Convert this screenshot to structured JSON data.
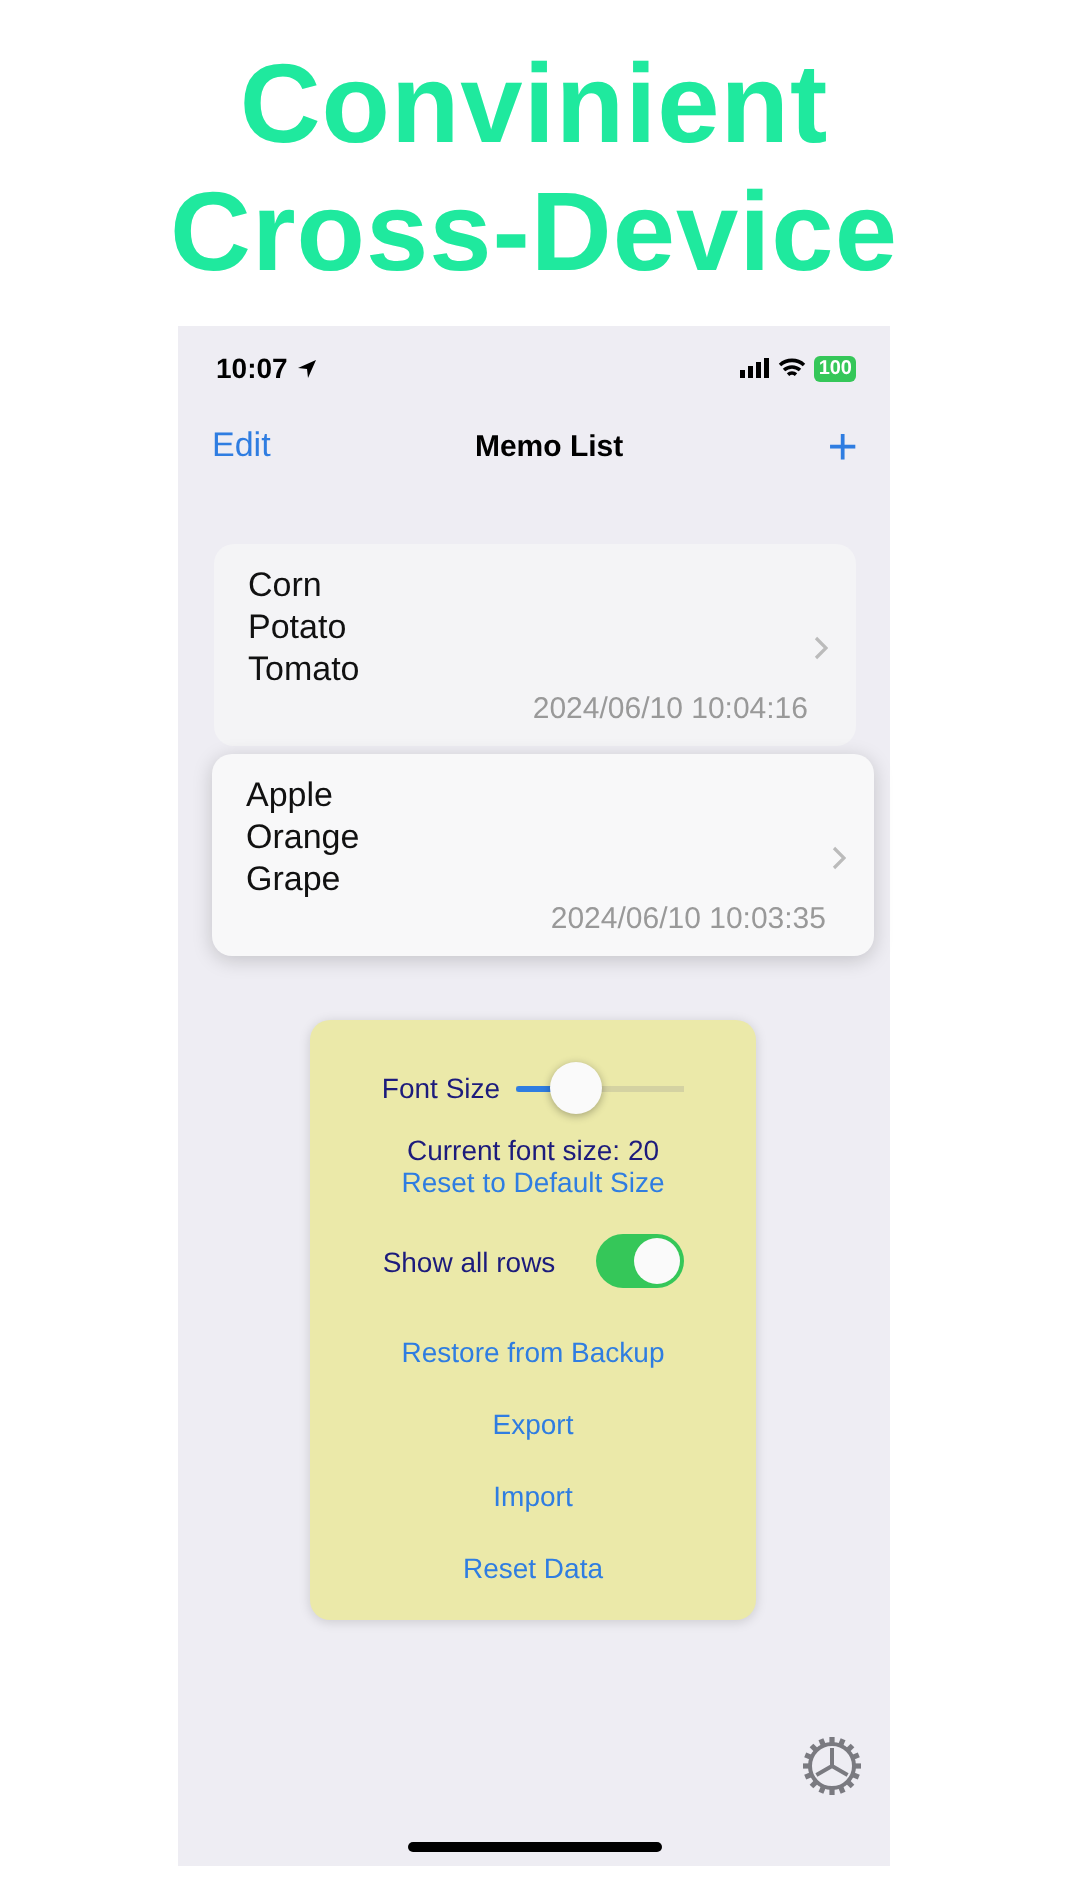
{
  "headline": [
    "Convinient",
    "Cross-Device"
  ],
  "status_bar": {
    "time": "10:07",
    "battery": "100"
  },
  "nav": {
    "left": "Edit",
    "title": "Memo List",
    "right": "+"
  },
  "memos": [
    {
      "lines": [
        "Corn",
        "Potato",
        "Tomato"
      ],
      "date": "2024/06/10 10:04:16"
    },
    {
      "lines": [
        "Apple",
        "Orange",
        "Grape"
      ],
      "date": "2024/06/10 10:03:35"
    }
  ],
  "settings": {
    "font_size": {
      "label": "Font Size",
      "level": 0.36
    },
    "current": "Current font size: 20",
    "reset_size": "Reset to Default Size",
    "show_all": {
      "label": "Show all rows",
      "on": true
    },
    "actions": [
      "Restore from Backup",
      "Export",
      "Import",
      "Reset Data"
    ]
  }
}
